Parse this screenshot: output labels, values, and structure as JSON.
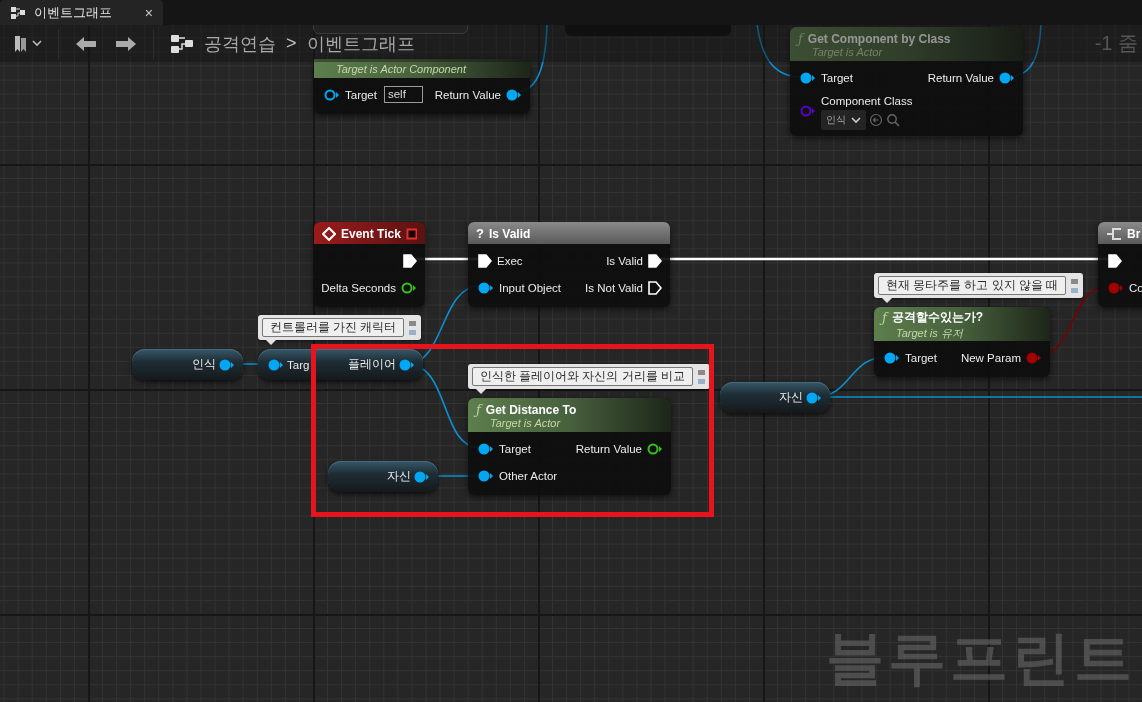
{
  "tab": {
    "label": "이벤트그래프",
    "close": "×"
  },
  "toolbar": {
    "breadcrumb": [
      "공격연습",
      "이벤트그래프"
    ],
    "separator": ">",
    "zoom": "-1 줌"
  },
  "graph_label": "블루프린트",
  "nodes": [
    {
      "kind": "function",
      "subtitle": "Target is Actor Component",
      "inputs": [
        {
          "label": "Target",
          "kind": "object",
          "connected": false,
          "default": "self"
        }
      ],
      "outputs": [
        {
          "label": "Return Value",
          "kind": "object",
          "connected": true
        }
      ]
    },
    {
      "kind": "function",
      "icon": "ƒ",
      "title": "Get Component by Class",
      "subtitle": "Target is Actor",
      "inputs": [
        {
          "label": "Target",
          "kind": "object",
          "connected": true
        },
        {
          "label": "Component Class",
          "kind": "class",
          "connected": false,
          "default": "인식"
        }
      ],
      "outputs": [
        {
          "label": "Return Value",
          "kind": "object",
          "connected": true
        }
      ]
    },
    {
      "kind": "event",
      "title": "Event Tick",
      "outputs": [
        {
          "kind": "exec",
          "connected": true
        },
        {
          "label": "Delta Seconds",
          "kind": "float",
          "connected": false
        }
      ]
    },
    {
      "kind": "macro",
      "icon": "?",
      "title": "Is Valid",
      "inputs": [
        {
          "label": "Exec",
          "kind": "exec",
          "connected": true
        },
        {
          "label": "Input Object",
          "kind": "object",
          "connected": true
        }
      ],
      "outputs": [
        {
          "label": "Is Valid",
          "kind": "exec",
          "connected": true
        },
        {
          "label": "Is Not Valid",
          "kind": "exec",
          "connected": false
        }
      ]
    },
    {
      "kind": "branch",
      "title": "Br",
      "inputs": [
        {
          "kind": "exec",
          "connected": true
        },
        {
          "label": "Co",
          "kind": "bool",
          "connected": true
        }
      ]
    },
    {
      "kind": "variable",
      "outputs": [
        {
          "label": "인식",
          "kind": "object",
          "connected": true
        }
      ]
    },
    {
      "kind": "getter",
      "comment": "컨트롤러를 가진 캐릭터",
      "inputs": [
        {
          "label": "Targ",
          "kind": "object",
          "connected": true
        }
      ],
      "outputs": [
        {
          "label": "플레이어",
          "kind": "object",
          "connected": true
        }
      ]
    },
    {
      "kind": "function",
      "icon": "ƒ",
      "title": "공격할수있는가?",
      "subtitle": "Target is 유저",
      "comment": "현재 몽타주를 하고 있지 않을 때",
      "inputs": [
        {
          "label": "Target",
          "kind": "object",
          "connected": true
        }
      ],
      "outputs": [
        {
          "label": "New Param",
          "kind": "bool",
          "connected": true
        }
      ]
    },
    {
      "kind": "variable",
      "outputs": [
        {
          "label": "자신",
          "kind": "object",
          "connected": true
        }
      ]
    },
    {
      "kind": "function",
      "icon": "ƒ",
      "title": "Get Distance To",
      "subtitle": "Target is Actor",
      "comment": "인식한 플레이어와 자신의 거리를 비교",
      "inputs": [
        {
          "label": "Target",
          "kind": "object",
          "connected": true
        },
        {
          "label": "Other Actor",
          "kind": "object",
          "connected": true
        }
      ],
      "outputs": [
        {
          "label": "Return Value",
          "kind": "float",
          "connected": false
        }
      ]
    },
    {
      "kind": "variable",
      "outputs": [
        {
          "label": "자신",
          "kind": "object",
          "connected": true
        }
      ]
    }
  ]
}
